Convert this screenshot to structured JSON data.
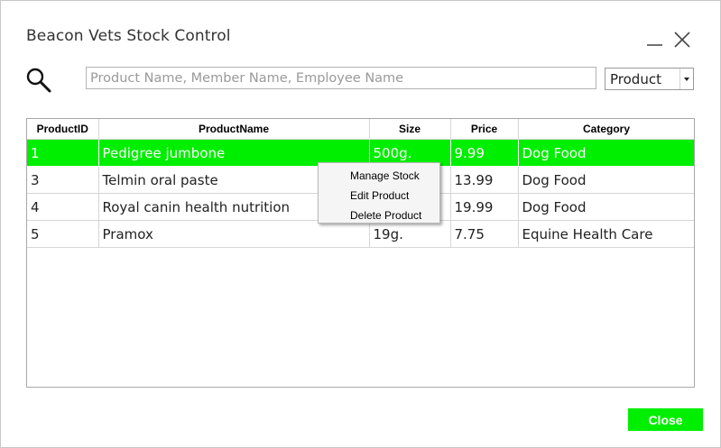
{
  "window": {
    "title": "Beacon Vets Stock Control"
  },
  "search": {
    "placeholder": "Product Name, Member Name, Employee Name",
    "value": "",
    "filter_selected": "Product"
  },
  "table": {
    "columns": [
      "ProductID",
      "ProductName",
      "Size",
      "Price",
      "Category"
    ],
    "rows": [
      {
        "id": "1",
        "name": "Pedigree jumbone",
        "size": "500g.",
        "price": "9.99",
        "category": "Dog Food"
      },
      {
        "id": "3",
        "name": "Telmin oral paste",
        "size": "",
        "price": "13.99",
        "category": "Dog Food"
      },
      {
        "id": "4",
        "name": "Royal canin health nutrition",
        "size": "",
        "price": "19.99",
        "category": "Dog Food"
      },
      {
        "id": "5",
        "name": "Pramox",
        "size": "19g.",
        "price": "7.75",
        "category": "Equine Health Care"
      }
    ],
    "selected_row": 0
  },
  "context_menu": {
    "items": [
      "Manage Stock",
      "Edit Product",
      "Delete Product"
    ]
  },
  "footer": {
    "close_label": "Close"
  },
  "colors": {
    "accent": "#00ee00",
    "accent_text": "#ffffff"
  },
  "icons": {
    "search": "search-icon",
    "minimize": "minimize-icon",
    "close": "close-icon",
    "dropdown": "chevron-down-icon"
  }
}
